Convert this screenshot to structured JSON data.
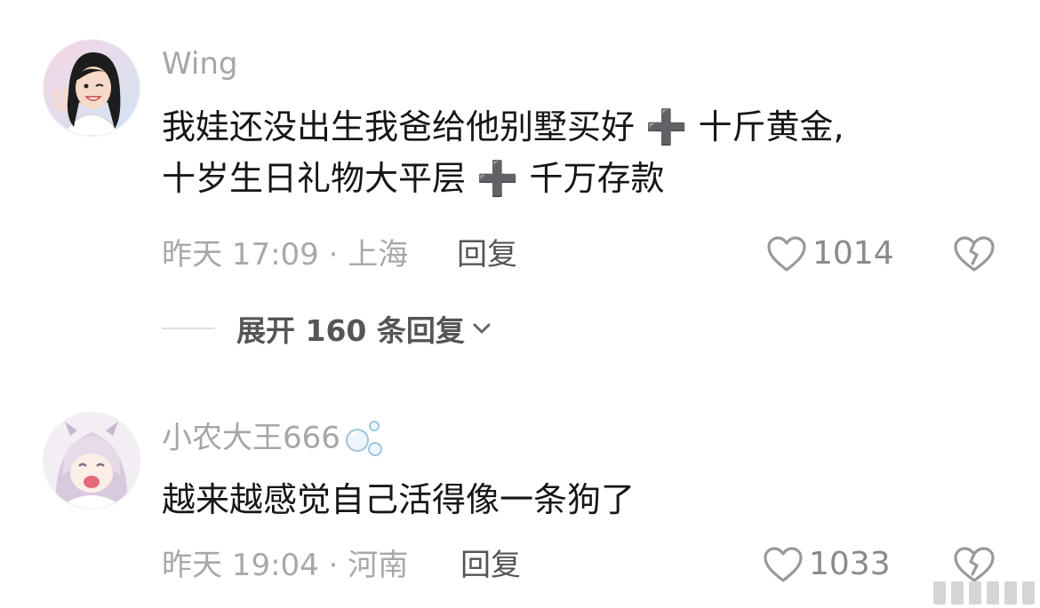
{
  "comments": [
    {
      "username": "Wing",
      "lines": [
        "我娃还没出生我爸给他别墅买好 ➕ 十斤黄金,",
        "十岁生日礼物大平层 ➕ 千万存款"
      ],
      "meta": "昨天 17:09 · 上海",
      "reply_label": "回复",
      "likes": "1014",
      "expand_label": "展开 160 条回复"
    },
    {
      "username": "小农大王666",
      "lines": [
        "越来越感觉自己活得像一条狗了"
      ],
      "meta": "昨天 19:04 · 河南",
      "reply_label": "回复",
      "likes": "1033"
    }
  ],
  "icons": {
    "like": "heart-outline-icon",
    "dislike": "broken-heart-icon",
    "expand": "chevron-down-icon",
    "username_decoration": "bubbles-icon"
  },
  "colors": {
    "username": "#a6a6a6",
    "text": "#161616",
    "meta": "#a8a8a8",
    "action": "#555555"
  }
}
